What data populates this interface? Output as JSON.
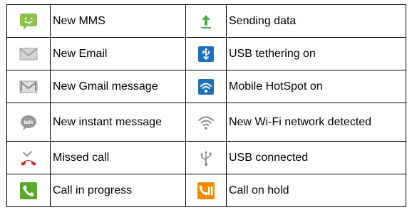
{
  "rows": [
    {
      "left": {
        "icon": "mms-icon",
        "label": "New MMS"
      },
      "right": {
        "icon": "upload-arrow-icon",
        "label": "Sending data"
      }
    },
    {
      "left": {
        "icon": "email-envelope-icon",
        "label": "New Email"
      },
      "right": {
        "icon": "usb-tethering-icon",
        "label": "USB tethering on"
      }
    },
    {
      "left": {
        "icon": "gmail-icon",
        "label": "New Gmail message"
      },
      "right": {
        "icon": "hotspot-icon",
        "label": "Mobile HotSpot on"
      }
    },
    {
      "left": {
        "icon": "talk-bubble-icon",
        "label": "New instant message"
      },
      "right": {
        "icon": "wifi-icon",
        "label": "New Wi-Fi network detected"
      }
    },
    {
      "left": {
        "icon": "missed-call-icon",
        "label": "Missed call"
      },
      "right": {
        "icon": "usb-icon",
        "label": "USB connected"
      }
    },
    {
      "left": {
        "icon": "call-in-progress-icon",
        "label": "Call in progress"
      },
      "right": {
        "icon": "call-on-hold-icon",
        "label": "Call on hold"
      }
    }
  ],
  "colors": {
    "mms_green": "#8bc34a",
    "usb_blue": "#1e6fc0",
    "missed_red": "#d32f2f",
    "call_green": "#58a82a",
    "hold_orange": "#f28c00",
    "gray_icon": "#8a8a8a"
  }
}
